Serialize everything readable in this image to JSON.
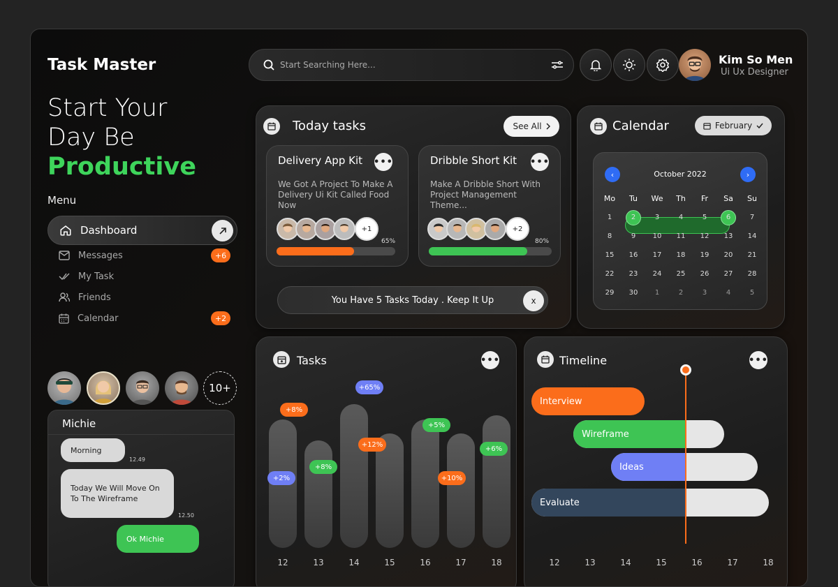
{
  "app": {
    "brand": "Task Master"
  },
  "hero": {
    "line1": "Start Your",
    "line2": "Day Be",
    "highlight": "Productive"
  },
  "menu": {
    "title": "Menu",
    "items": [
      {
        "label": "Dashboard",
        "icon": "home-icon",
        "active": true
      },
      {
        "label": "Messages",
        "icon": "mail-icon",
        "badge": "+6"
      },
      {
        "label": "My Task",
        "icon": "check-icon"
      },
      {
        "label": "Friends",
        "icon": "users-icon"
      },
      {
        "label": "Calendar",
        "icon": "calendar-icon",
        "badge": "+2"
      }
    ]
  },
  "contacts": {
    "more": "10+"
  },
  "chat": {
    "name": "Michie",
    "messages": [
      {
        "text": "Morning",
        "time": "12.49"
      },
      {
        "text": "Today We Will Move On To The Wireframe",
        "time": "12.50"
      },
      {
        "text": "Ok Michie",
        "time": ""
      }
    ]
  },
  "search": {
    "placeholder": "Start Searching Here..."
  },
  "user": {
    "name": "Kim So Men",
    "role": "Ui Ux Designer"
  },
  "today_tasks": {
    "title": "Today tasks",
    "see_all": "See All",
    "cards": [
      {
        "title": "Delivery App Kit",
        "desc": "We Got A Project To Make A Delivery Ui Kit Called Food Now",
        "more": "+1",
        "progress": 65,
        "progress_label": "65%",
        "color": "#fb6d1b"
      },
      {
        "title": "Dribble Short Kit",
        "desc": "Make A Dribble Short With Project Management Theme...",
        "more": "+2",
        "progress": 80,
        "progress_label": "80%",
        "color": "#3ec454"
      }
    ],
    "notice": "You Have 5 Tasks Today . Keep It Up",
    "notice_close": "x"
  },
  "calendar": {
    "title": "Calendar",
    "month_button": "February",
    "month_label": "October 2022",
    "weekdays": [
      "Mo",
      "Tu",
      "We",
      "Th",
      "Fr",
      "Sa",
      "Su"
    ],
    "rows": [
      [
        "1",
        "2",
        "3",
        "4",
        "5",
        "6",
        "7"
      ],
      [
        "8",
        "9",
        "10",
        "11",
        "12",
        "13",
        "14"
      ],
      [
        "15",
        "16",
        "17",
        "18",
        "19",
        "20",
        "21"
      ],
      [
        "22",
        "23",
        "24",
        "25",
        "26",
        "27",
        "28"
      ],
      [
        "29",
        "30",
        "1",
        "2",
        "3",
        "4",
        "5"
      ]
    ],
    "range_start": "2",
    "range_end": "6"
  },
  "tasks_chart": {
    "title": "Tasks",
    "chart_data": {
      "type": "bar",
      "categories": [
        "12",
        "13",
        "14",
        "15",
        "16",
        "17",
        "18"
      ],
      "bars": [
        {
          "x": "12",
          "label": "+2%",
          "color": "#6f7ff5"
        },
        {
          "x": "12",
          "label": "+8%",
          "color": "#fb6d1b"
        },
        {
          "x": "13",
          "label": "+8%",
          "color": "#3ec454"
        },
        {
          "x": "14",
          "label": "+65%",
          "color": "#6f7ff5"
        },
        {
          "x": "15",
          "label": "+12%",
          "color": "#fb6d1b"
        },
        {
          "x": "16",
          "label": "+5%",
          "color": "#3ec454"
        },
        {
          "x": "17",
          "label": "+10%",
          "color": "#fb6d1b"
        },
        {
          "x": "18",
          "label": "+6%",
          "color": "#3ec454"
        }
      ]
    }
  },
  "timeline": {
    "title": "Timeline",
    "x_labels": [
      "12",
      "13",
      "14",
      "15",
      "16",
      "17",
      "18"
    ],
    "items": [
      {
        "label": "Interview",
        "color": "#fb6d1b",
        "text_color": "#fff"
      },
      {
        "label": "Wireframe",
        "color": "#3ec454",
        "text_color": "#fff"
      },
      {
        "label": "Ideas",
        "color": "#6f7ff5",
        "text_color": "#fff"
      },
      {
        "label": "Evaluate",
        "color": "#33465c",
        "text_color": "#fff"
      }
    ]
  },
  "colors": {
    "accent_green": "#3ec454",
    "accent_orange": "#fb6d1b",
    "accent_blue": "#2f6cf5"
  }
}
